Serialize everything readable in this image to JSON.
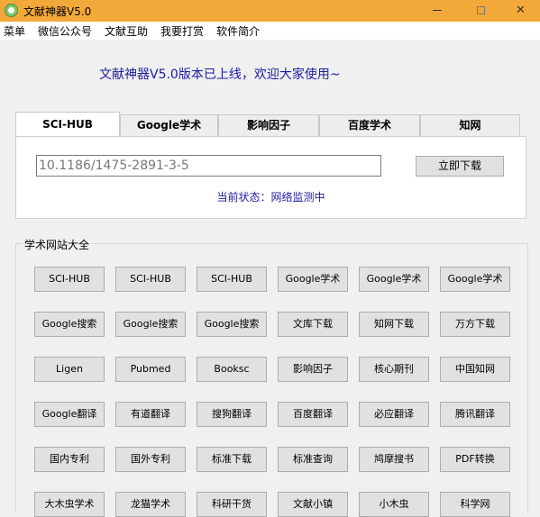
{
  "window": {
    "title": "文献神器V5.0",
    "close_glyph": "✕"
  },
  "menu": [
    "菜单",
    "微信公众号",
    "文献互助",
    "我要打赏",
    "软件简介"
  ],
  "banner": "文献神器V5.0版本已上线，欢迎大家使用~",
  "tabs": [
    {
      "label": "SCI-HUB",
      "active": true
    },
    {
      "label": "Google学术",
      "active": false
    },
    {
      "label": "影响因子",
      "active": false
    },
    {
      "label": "百度学术",
      "active": false
    },
    {
      "label": "知网",
      "active": false
    }
  ],
  "search": {
    "value": "10.1186/1475-2891-3-5",
    "download_label": "立即下载",
    "status": "当前状态：网络监测中"
  },
  "sites": {
    "title": "学术网站大全",
    "buttons": [
      [
        "SCI-HUB",
        "SCI-HUB",
        "SCI-HUB",
        "Google学术",
        "Google学术",
        "Google学术"
      ],
      [
        "Google搜索",
        "Google搜索",
        "Google搜索",
        "文库下载",
        "知网下载",
        "万方下载"
      ],
      [
        "Ligen",
        "Pubmed",
        "Booksc",
        "影响因子",
        "核心期刊",
        "中国知网"
      ],
      [
        "Google翻译",
        "有道翻译",
        "搜狗翻译",
        "百度翻译",
        "必应翻译",
        "腾讯翻译"
      ],
      [
        "国内专利",
        "国外专利",
        "标准下载",
        "标准查询",
        "鸠摩搜书",
        "PDF转换"
      ],
      [
        "大木虫学术",
        "龙猫学术",
        "科研干货",
        "文献小镇",
        "小木虫",
        "科学网"
      ]
    ]
  }
}
